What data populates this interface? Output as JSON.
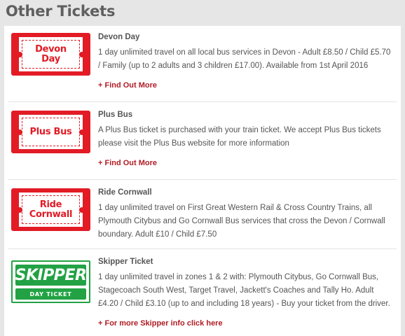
{
  "page": {
    "title": "Other Tickets"
  },
  "tickets": [
    {
      "logo_lines": [
        "Devon",
        "Day"
      ],
      "title": "Devon Day",
      "description": "1 day unlimited travel on all local bus services in Devon - Adult £8.50 / Child £5.70 / Family (up to 2 adults and 3 children £17.00). Available from 1st April 2016",
      "link": "+ Find Out More"
    },
    {
      "logo_lines": [
        "Plus Bus"
      ],
      "title": "Plus Bus",
      "description": "A Plus Bus ticket is purchased with your train ticket. We accept Plus Bus tickets please visit the Plus Bus website for more information",
      "link": "+ Find Out More"
    },
    {
      "logo_lines": [
        "Ride",
        "Cornwall"
      ],
      "title": "Ride Cornwall",
      "description": "1 day unlimited travel on First Great Western Rail & Cross Country Trains, all Plymouth Citybus and Go Cornwall Bus services that cross the Devon / Cornwall boundary. Adult £10 / Child £7.50",
      "link": ""
    },
    {
      "logo_lines": [
        "SKIPPER",
        "DAY TICKET"
      ],
      "title": "Skipper Ticket",
      "description": "1 day unlimited travel in zones 1 & 2 with: Plymouth Citybus, Go Cornwall Bus, Stagecoach South West, Target Travel, Jackett's Coaches and Tally Ho. Adult £4.20 / Child £3.10 (up to and including 18 years) - Buy your ticket from the driver.",
      "link": "+ For more Skipper info click here"
    }
  ],
  "colors": {
    "brand_red": "#e21b25",
    "link_red": "#b01c24",
    "skipper_green": "#22a244"
  }
}
